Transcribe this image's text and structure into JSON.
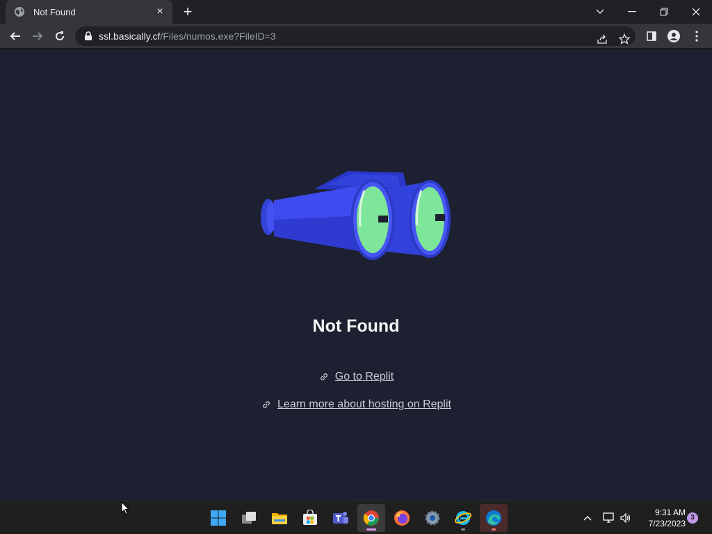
{
  "browser": {
    "tab_title": "Not Found",
    "tab_close_glyph": "×",
    "new_tab_glyph": "+",
    "url_host": "ssl.basically.cf",
    "url_path": "/Files/numos.exe?FileID=3"
  },
  "page": {
    "title": "Not Found",
    "links": [
      {
        "label": "Go to Replit"
      },
      {
        "label": "Learn more about hosting on Replit"
      }
    ]
  },
  "taskbar": {
    "time": "9:31 AM",
    "date": "7/23/2023",
    "notification_count": "3",
    "apps": [
      "start-icon",
      "task-view-icon",
      "file-explorer-icon",
      "store-icon",
      "teams-icon",
      "chrome-icon",
      "firefox-icon",
      "settings-icon",
      "internet-explorer-icon",
      "edge-icon"
    ]
  },
  "colors": {
    "page_bg": "#1c2030",
    "binoculars_blue": "#3f4ef0",
    "lens_green": "#7ee69a",
    "text": "#f5f5f5"
  }
}
